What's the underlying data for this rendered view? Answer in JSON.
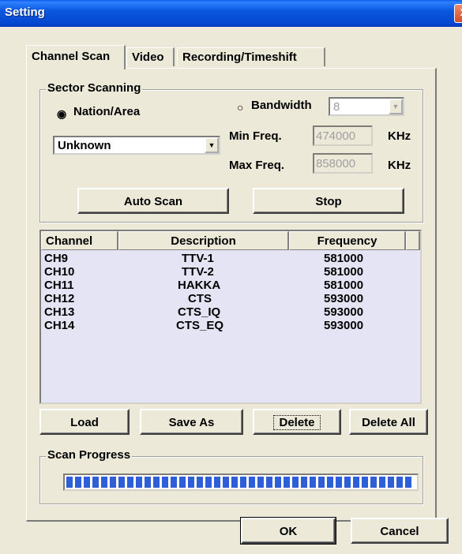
{
  "window": {
    "title": "Setting",
    "close_glyph": "x"
  },
  "tabs": [
    {
      "label": "Channel Scan",
      "active": true
    },
    {
      "label": "Video",
      "active": false
    },
    {
      "label": "Recording/Timeshift",
      "active": false
    }
  ],
  "sector": {
    "group_label": "Sector Scanning",
    "nation_label": "Nation/Area",
    "nation_selected": true,
    "nation_value": "Unknown",
    "bandwidth_label": "Bandwidth",
    "bandwidth_selected": false,
    "bandwidth_value": "8",
    "min_label": "Min Freq.",
    "min_value": "474000",
    "max_label": "Max Freq.",
    "max_value": "858000",
    "unit": "KHz",
    "auto_scan": "Auto Scan",
    "stop": "Stop"
  },
  "list": {
    "columns": [
      "Channel",
      "Description",
      "Frequency"
    ],
    "rows": [
      [
        "CH9",
        "TTV-1",
        "581000"
      ],
      [
        "CH10",
        "TTV-2",
        "581000"
      ],
      [
        "CH11",
        "HAKKA",
        "581000"
      ],
      [
        "CH12",
        "CTS",
        "593000"
      ],
      [
        "CH13",
        "CTS_IQ",
        "593000"
      ],
      [
        "CH14",
        "CTS_EQ",
        "593000"
      ]
    ]
  },
  "list_buttons": {
    "load": "Load",
    "save_as": "Save As",
    "delete": "Delete",
    "delete_all": "Delete All"
  },
  "progress": {
    "label": "Scan Progress",
    "fraction": 1.0
  },
  "footer": {
    "ok": "OK",
    "cancel": "Cancel"
  },
  "colors": {
    "title_bar": "#0a5ce8",
    "list_bg": "#e4e4f4",
    "progress_fill": "#2f5fd8",
    "face": "#ece9d8"
  }
}
